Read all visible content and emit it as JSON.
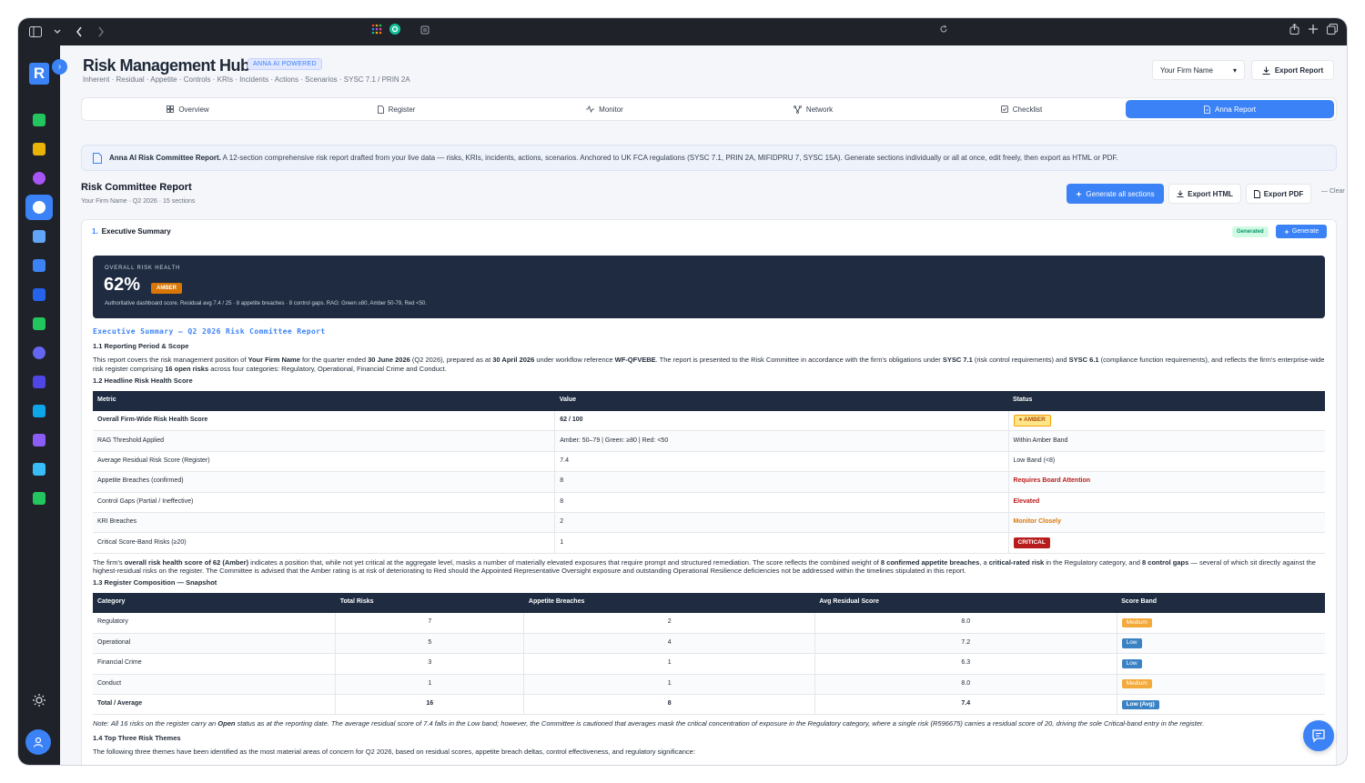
{
  "header": {
    "title": "Risk Management Hub",
    "badge": "ANNA AI POWERED",
    "subtitle": "Inherent · Residual · Appetite · Controls · KRIs · Incidents · Actions · Scenarios · SYSC 7.1 / PRIN 2A",
    "firm_select": "Your Firm Name",
    "export_report": "Export Report"
  },
  "tabs": [
    {
      "label": "Overview",
      "icon": "grid-icon"
    },
    {
      "label": "Register",
      "icon": "document-icon"
    },
    {
      "label": "Monitor",
      "icon": "pulse-icon"
    },
    {
      "label": "Network",
      "icon": "network-icon"
    },
    {
      "label": "Checklist",
      "icon": "checkbox-icon"
    },
    {
      "label": "Anna Report",
      "icon": "report-icon"
    }
  ],
  "banner": {
    "title": "Anna AI Risk Committee Report.",
    "text": " A 12-section comprehensive risk report drafted from your live data — risks, KRIs, incidents, actions, scenarios. Anchored to UK FCA regulations (SYSC 7.1, PRIN 2A, MIFIDPRU 7, SYSC 15A). Generate sections individually or all at once, edit freely, then export as HTML or PDF."
  },
  "report": {
    "title": "Risk Committee Report",
    "meta": "Your Firm Name · Q2 2026 · 15 sections",
    "generate_all": "Generate all sections",
    "export_html": "Export HTML",
    "export_pdf": "Export PDF",
    "clear": "Clear"
  },
  "section": {
    "num": "1.",
    "title": "Executive Summary",
    "status": "Generated",
    "generate": "Generate"
  },
  "health": {
    "label": "OVERALL RISK HEALTH",
    "score": "62%",
    "rag": "AMBER",
    "note": "Authoritative dashboard score. Residual avg 7.4 / 25 · 8 appetite breaches · 8 control gaps. RAG: Green ≥80, Amber 50-79, Red <50."
  },
  "content": {
    "heading": "Executive Summary — Q2 2026 Risk Committee Report",
    "h11": "1.1 Reporting Period & Scope",
    "p11_a": "This report covers the risk management position of ",
    "p11_firm": "Your Firm Name",
    "p11_b": " for the quarter ended ",
    "p11_date1": "30 June 2026",
    "p11_c": " (Q2 2026), prepared as at ",
    "p11_date2": "30 April 2026",
    "p11_d": " under workflow reference ",
    "p11_ref": "WF-QFVEBE",
    "p11_e": ". The report is presented to the Risk Committee in accordance with the firm's obligations under ",
    "p11_sysc71": "SYSC 7.1",
    "p11_f": " (risk control requirements) and ",
    "p11_sysc61": "SYSC 6.1",
    "p11_g": " (compliance function requirements), and reflects the firm's enterprise-wide risk register comprising ",
    "p11_open": "16 open risks",
    "p11_h": " across four categories: Regulatory, Operational, Financial Crime and Conduct.",
    "h12": "1.2 Headline Risk Health Score",
    "p12_a": "The firm's ",
    "p12_b1": "overall risk health score of 62 (Amber)",
    "p12_b": " indicates a position that, while not yet critical at the aggregate level, masks a number of materially elevated exposures that require prompt and structured remediation. The score reflects the combined weight of ",
    "p12_b2": "8 confirmed appetite breaches",
    "p12_c": ", a ",
    "p12_b3": "critical-rated risk",
    "p12_d": " in the Regulatory category, and ",
    "p12_b4": "8 control gaps",
    "p12_e": " — several of which sit directly against the highest-residual risks on the register. The Committee is advised that the Amber rating is at risk of deteriorating to Red should the Appointed Representative Oversight exposure and outstanding Operational Resilience deficiencies not be addressed within the timelines stipulated in this report.",
    "h13": "1.3 Register Composition — Snapshot",
    "note_a": "Note: All 16 risks on the register carry an ",
    "note_open": "Open",
    "note_b": " status as at the reporting date. The average residual score of 7.4 falls in the Low band; however, the Committee is cautioned that averages mask the critical concentration of exposure in the Regulatory category, where a single risk (R596675) carries a residual score of 20, driving the sole Critical-band entry in the register.",
    "h14": "1.4 Top Three Risk Themes",
    "p14": "The following three themes have been identified as the most material areas of concern for Q2 2026, based on residual scores, appetite breach deltas, control effectiveness, and regulatory significance:"
  },
  "table1": {
    "headers": [
      "Metric",
      "Value",
      "Status"
    ],
    "rows": [
      {
        "metric": "Overall Firm-Wide Risk Health Score",
        "value": "62 / 100",
        "status": "● AMBER"
      },
      {
        "metric": "RAG Threshold Applied",
        "value": "Amber: 50–79 | Green: ≥80 | Red: <50",
        "status": "Within Amber Band"
      },
      {
        "metric": "Average Residual Risk Score (Register)",
        "value": "7.4",
        "status": "Low Band (<8)"
      },
      {
        "metric": "Appetite Breaches (confirmed)",
        "value": "8",
        "status": "Requires Board Attention"
      },
      {
        "metric": "Control Gaps (Partial / Ineffective)",
        "value": "8",
        "status": "Elevated"
      },
      {
        "metric": "KRI Breaches",
        "value": "2",
        "status": "Monitor Closely"
      },
      {
        "metric": "Critical Score-Band Risks (≥20)",
        "value": "1",
        "status": "CRITICAL"
      }
    ]
  },
  "table2": {
    "headers": [
      "Category",
      "Total Risks",
      "Appetite Breaches",
      "Avg Residual Score",
      "Score Band"
    ],
    "rows": [
      {
        "cat": "Regulatory",
        "total": "7",
        "breaches": "2",
        "avg": "8.0",
        "band": "Medium"
      },
      {
        "cat": "Operational",
        "total": "5",
        "breaches": "4",
        "avg": "7.2",
        "band": "Low"
      },
      {
        "cat": "Financial Crime",
        "total": "3",
        "breaches": "1",
        "avg": "6.3",
        "band": "Low"
      },
      {
        "cat": "Conduct",
        "total": "1",
        "breaches": "1",
        "avg": "8.0",
        "band": "Medium"
      },
      {
        "cat": "Total / Average",
        "total": "16",
        "breaches": "8",
        "avg": "7.4",
        "band": "Low (Avg)"
      }
    ]
  },
  "colors": {
    "accent": "#3b82f6",
    "navy": "#1e2b40",
    "amber": "#d97706",
    "critical": "#b91c1c"
  }
}
